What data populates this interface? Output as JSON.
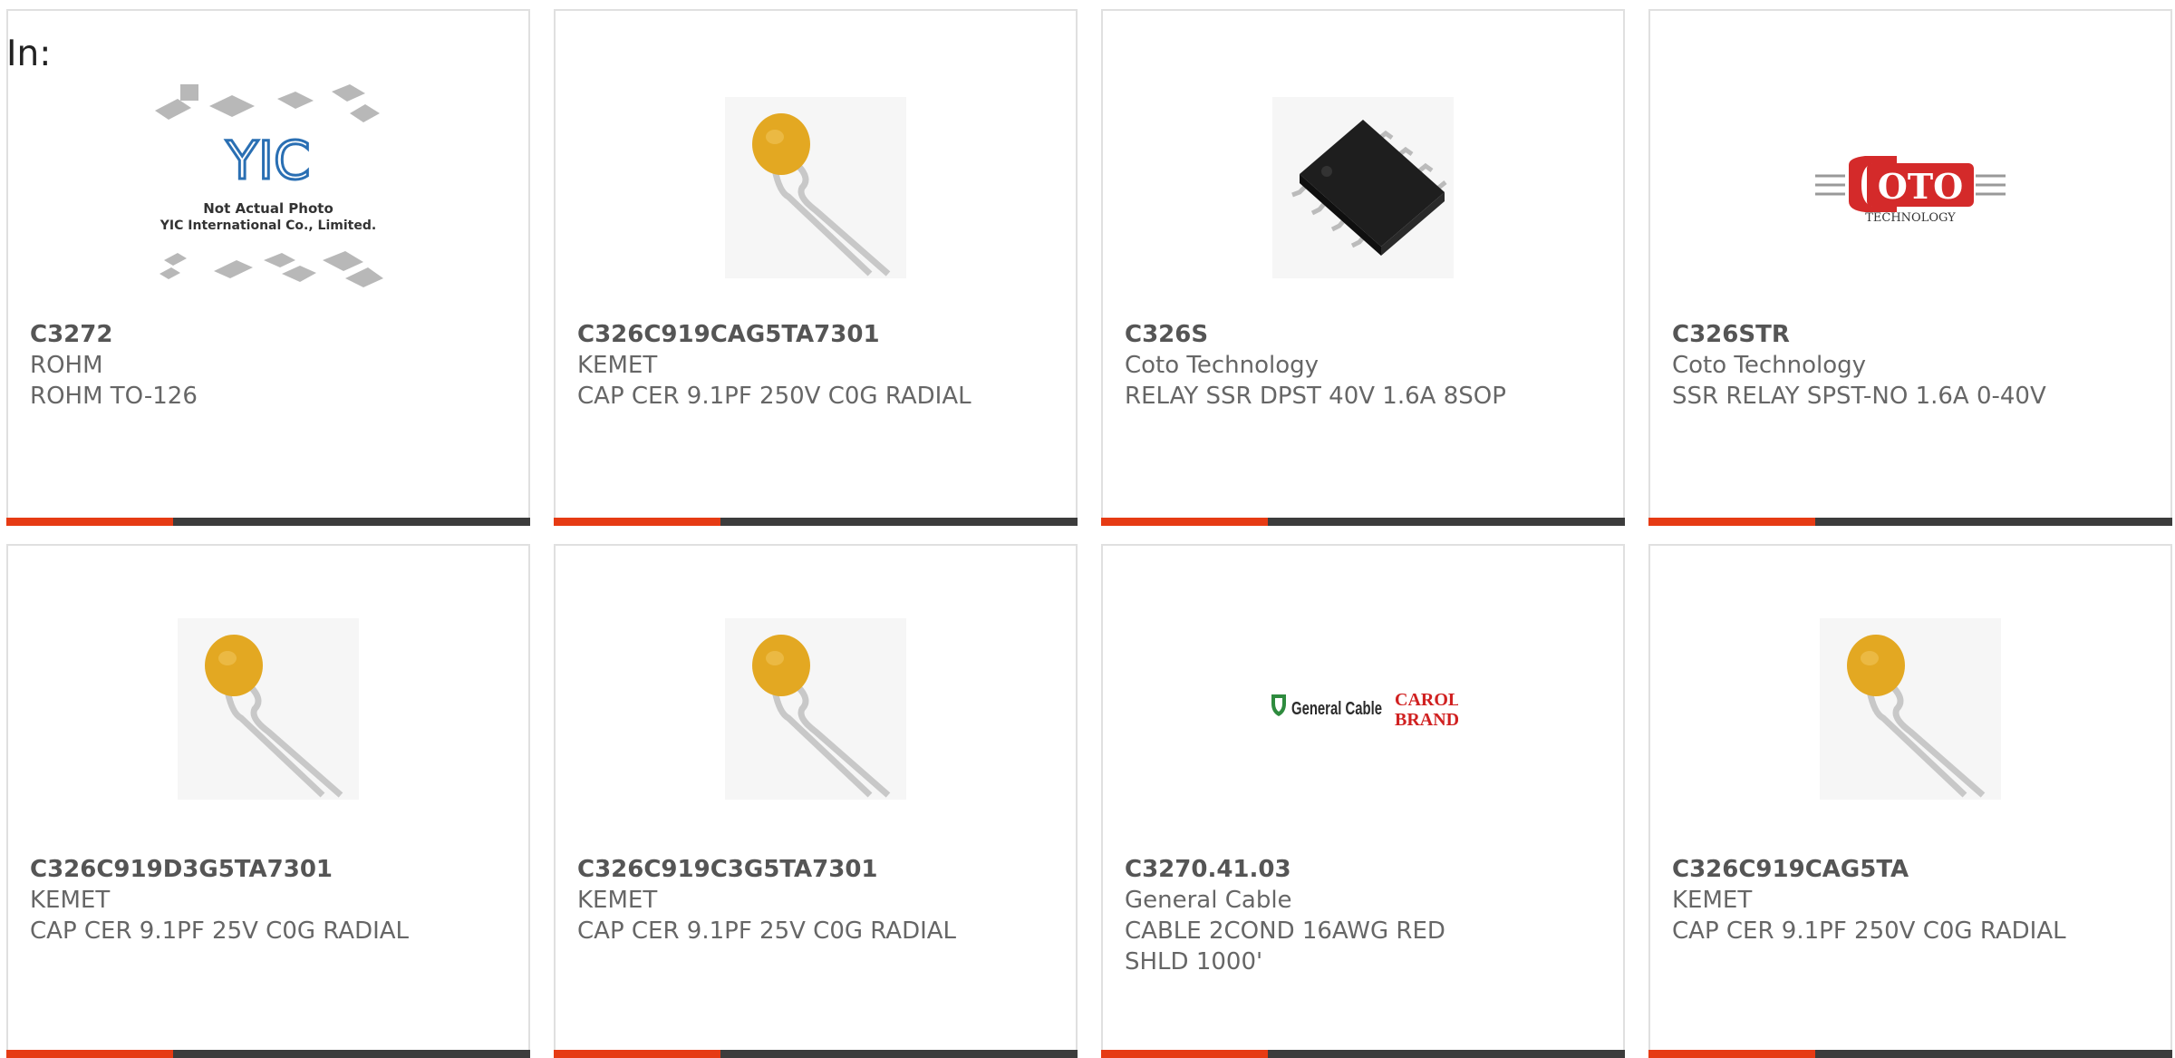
{
  "header": {
    "in_label": "In:"
  },
  "products": [
    {
      "part_number": "C3272",
      "manufacturer": "ROHM",
      "description": "ROHM TO-126",
      "image": "not-actual-photo-placeholder",
      "placeholder_text": [
        "YIC",
        "Not Actual Photo",
        "YIC International Co., Limited."
      ]
    },
    {
      "part_number": "C326C919CAG5TA7301",
      "manufacturer": "KEMET",
      "description": "CAP CER 9.1PF 250V C0G RADIAL",
      "image": "radial-capacitor-photo"
    },
    {
      "part_number": "C326S",
      "manufacturer": "Coto Technology",
      "description": "RELAY SSR DPST 40V 1.6A 8SOP",
      "image": "sop8-chip-photo"
    },
    {
      "part_number": "C326STR",
      "manufacturer": "Coto Technology",
      "description": "SSR RELAY SPST-NO 1.6A 0-40V",
      "image": "coto-technology-logo",
      "logo_text": [
        "OTO",
        "TECHNOLOGY"
      ]
    },
    {
      "part_number": "C326C919D3G5TA7301",
      "manufacturer": "KEMET",
      "description": "CAP CER 9.1PF 25V C0G RADIAL",
      "image": "radial-capacitor-photo"
    },
    {
      "part_number": "C326C919C3G5TA7301",
      "manufacturer": "KEMET",
      "description": "CAP CER 9.1PF 25V C0G RADIAL",
      "image": "radial-capacitor-photo"
    },
    {
      "part_number": "C3270.41.03",
      "manufacturer": "General Cable",
      "description": "CABLE 2COND 16AWG RED SHLD 1000'",
      "image": "general-cable-carol-brand-logo",
      "logo_text": [
        "General Cable",
        "CAROL",
        "BRAND"
      ]
    },
    {
      "part_number": "C326C919CAG5TA",
      "manufacturer": "KEMET",
      "description": "CAP CER 9.1PF 250V C0G RADIAL",
      "image": "radial-capacitor-photo"
    }
  ],
  "colors": {
    "accent": "#e63b14",
    "bar": "#3c3c3c",
    "border": "#e0e0e0",
    "text": "#666666",
    "capacitor": "#e3a822",
    "coto_red": "#d42a2a",
    "gc_green": "#2e8b3e",
    "carol_red": "#d02020"
  }
}
